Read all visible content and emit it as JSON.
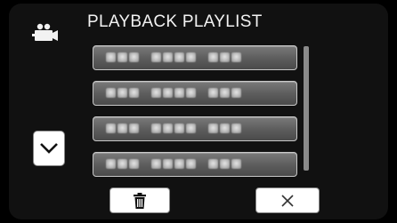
{
  "header": {
    "title": "PLAYBACK PLAYLIST",
    "mode_icon": "video-camera-icon"
  },
  "playlist": {
    "items": [
      {
        "label": "",
        "blurred": true
      },
      {
        "label": "",
        "blurred": true
      },
      {
        "label": "",
        "blurred": true
      },
      {
        "label": "",
        "blurred": true
      }
    ]
  },
  "controls": {
    "scroll_down_icon": "chevron-down-icon",
    "delete_icon": "trash-icon",
    "close_icon": "close-icon"
  },
  "colors": {
    "background": "#111111",
    "item_fill": "#5e5e5e",
    "item_border": "#c8c8c8",
    "button_fill": "#ffffff",
    "text": "#f2f2f2"
  }
}
